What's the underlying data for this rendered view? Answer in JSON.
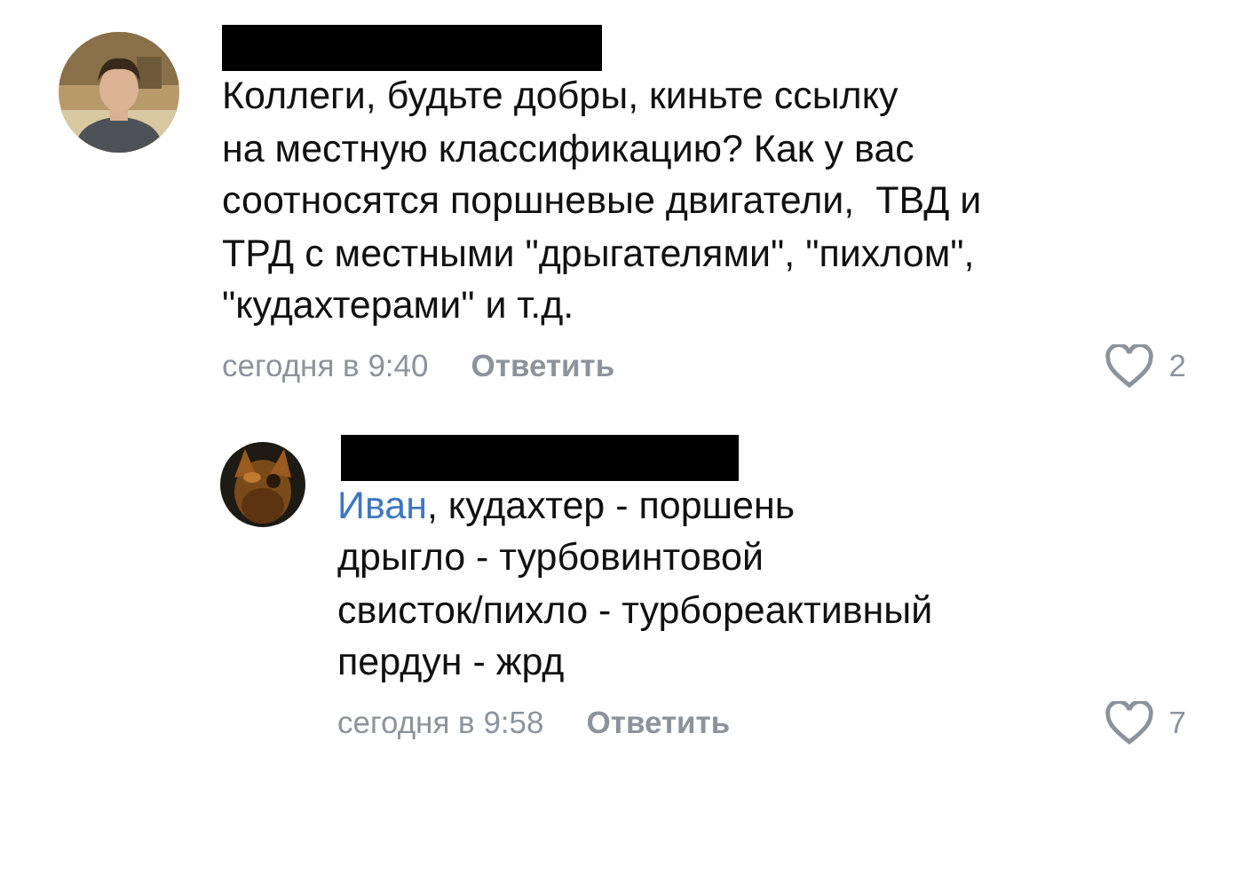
{
  "comments": [
    {
      "author": {
        "redacted": true
      },
      "text": "Коллеги, будьте добры, киньте ссылку\nна местную классификацию? Как у вас\nсоотносятся поршневые двигатели,  ТВД и\nТРД с местными \"дрыгателями\", \"пихлом\",\n\"кудахтерами\" и т.д.",
      "time": "сегодня в 9:40",
      "reply": "Ответить",
      "likes": "2",
      "liked": false,
      "nested": false
    },
    {
      "author": {
        "redacted": true
      },
      "mention": "Иван",
      "text": ", кудахтер - поршень\nдрыгло - турбовинтовой\nсвисток/пихло - турбореактивный\nпердун - жрд",
      "time": "сегодня в 9:58",
      "reply": "Ответить",
      "likes": "7",
      "liked": false,
      "nested": true
    }
  ]
}
